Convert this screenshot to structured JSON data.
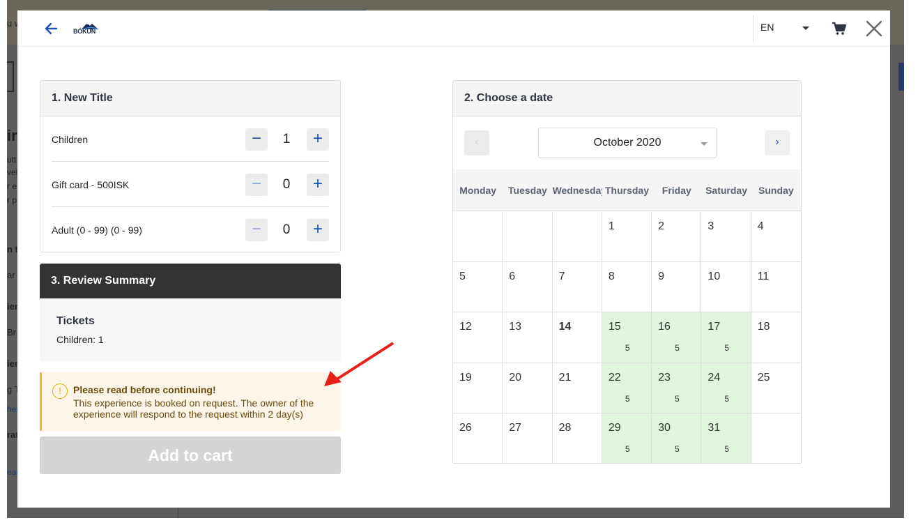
{
  "header": {
    "logo_text": "BÓKUN",
    "language": "EN"
  },
  "background": {
    "fragments": [
      "u w",
      "ir",
      "utt",
      "vel",
      "r e",
      "r p",
      "n tr",
      "ar",
      "ier",
      "Br",
      "ier",
      "g T",
      "her",
      "rat",
      "ear"
    ]
  },
  "tickets_panel": {
    "title": "1. New Title",
    "rows": [
      {
        "label": "Children",
        "quantity": "1",
        "minus": "−",
        "plus": "+"
      },
      {
        "label": "Gift card - 500ISK",
        "quantity": "0",
        "minus": "−",
        "plus": "+"
      },
      {
        "label": "Adult (0 - 99) (0 - 99)",
        "quantity": "0",
        "minus": "−",
        "plus": "+"
      }
    ]
  },
  "review": {
    "title": "3. Review Summary",
    "tickets_heading": "Tickets",
    "tickets_line": "Children: 1"
  },
  "warning": {
    "icon": "!",
    "title": "Please read before continuing!",
    "text": "This experience is booked on request. The owner of the experience will respond to the request within 2 day(s)"
  },
  "add_to_cart": "Add to cart",
  "calendar": {
    "title": "2. Choose a date",
    "month": "October 2020",
    "prev": "‹",
    "next": "›",
    "weekdays": [
      "Monday",
      "Tuesday",
      "Wednesday",
      "Thursday",
      "Friday",
      "Saturday",
      "Sunday"
    ],
    "weeks": [
      [
        {
          "d": ""
        },
        {
          "d": ""
        },
        {
          "d": ""
        },
        {
          "d": "1"
        },
        {
          "d": "2"
        },
        {
          "d": "3"
        },
        {
          "d": "4"
        }
      ],
      [
        {
          "d": "5"
        },
        {
          "d": "6"
        },
        {
          "d": "7"
        },
        {
          "d": "8"
        },
        {
          "d": "9"
        },
        {
          "d": "10"
        },
        {
          "d": "11"
        }
      ],
      [
        {
          "d": "12"
        },
        {
          "d": "13"
        },
        {
          "d": "14",
          "today": true
        },
        {
          "d": "15",
          "avail": "5"
        },
        {
          "d": "16",
          "avail": "5"
        },
        {
          "d": "17",
          "avail": "5"
        },
        {
          "d": "18"
        }
      ],
      [
        {
          "d": "19"
        },
        {
          "d": "20"
        },
        {
          "d": "21"
        },
        {
          "d": "22",
          "avail": "5"
        },
        {
          "d": "23",
          "avail": "5"
        },
        {
          "d": "24",
          "avail": "5"
        },
        {
          "d": "25"
        }
      ],
      [
        {
          "d": "26"
        },
        {
          "d": "27"
        },
        {
          "d": "28"
        },
        {
          "d": "29",
          "avail": "5"
        },
        {
          "d": "30",
          "avail": "5"
        },
        {
          "d": "31",
          "avail": "5"
        },
        {
          "d": ""
        }
      ]
    ]
  },
  "colors": {
    "accent": "#1a56b8",
    "available_day": "#e1f5de",
    "warning_bg": "#fdf6e8",
    "warning_border": "#f0b91e",
    "annotation_arrow": "#e8201c"
  }
}
